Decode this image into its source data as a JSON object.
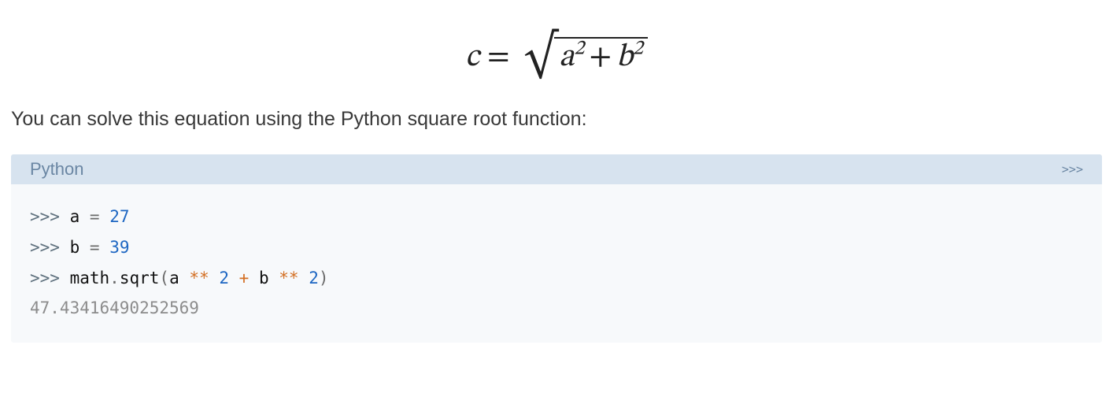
{
  "equation": {
    "lhs_var": "c",
    "rhs_a": "a",
    "rhs_b": "b",
    "exp_a": "2",
    "exp_b": "2",
    "relation": "=",
    "radical": "√",
    "plus": "+"
  },
  "intro_text": "You can solve this equation using the Python square root function:",
  "codeblock": {
    "language_label": "Python",
    "repl_marker": ">>>",
    "lines": [
      {
        "prompt": ">>>",
        "lhs": "a",
        "assign": "=",
        "value": "27"
      },
      {
        "prompt": ">>>",
        "lhs": "b",
        "assign": "=",
        "value": "39"
      },
      {
        "prompt": ">>>",
        "call_obj": "math",
        "dot": ".",
        "call_fn": "sqrt",
        "lp": "(",
        "arg1": "a",
        "pow1": "**",
        "exp1": "2",
        "plus": "+",
        "arg2": "b",
        "pow2": "**",
        "exp2": "2",
        "rp": ")"
      },
      {
        "output": "47.43416490252569"
      }
    ]
  }
}
